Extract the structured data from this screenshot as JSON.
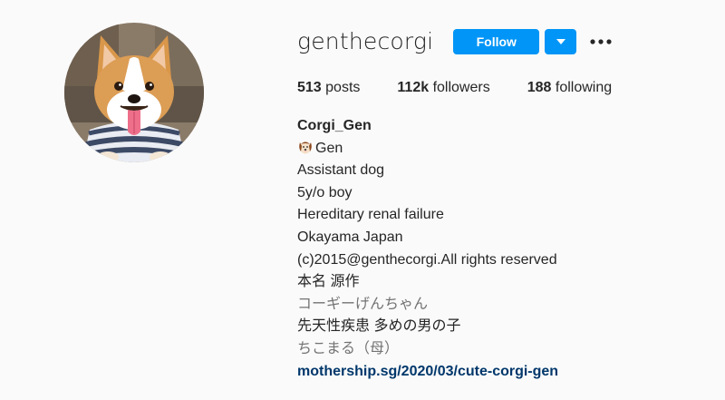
{
  "profile": {
    "username": "genthecorgi",
    "follow_label": "Follow",
    "dropdown_icon": "chevron-down-icon",
    "more_icon": "more-options-icon",
    "accent_color": "#0095f6"
  },
  "stats": {
    "posts_count": "513",
    "posts_label": "posts",
    "followers_count": "112k",
    "followers_label": "followers",
    "following_count": "188",
    "following_label": "following"
  },
  "bio": {
    "name": "Corgi_Gen",
    "line1_icon": "dog-face-icon",
    "line1_text": "Gen",
    "line2": "Assistant dog",
    "line3": "5y/o boy",
    "line4": "Hereditary renal failure",
    "line5": "Okayama Japan",
    "line6": "(c)2015@genthecorgi.All rights reserved",
    "line7": "本名 源作",
    "line8": "コーギーげんちゃん",
    "line9": "先天性疾患 多めの男の子",
    "line10": "ちこまる（母）",
    "link": "mothership.sg/2020/03/cute-corgi-gen"
  }
}
